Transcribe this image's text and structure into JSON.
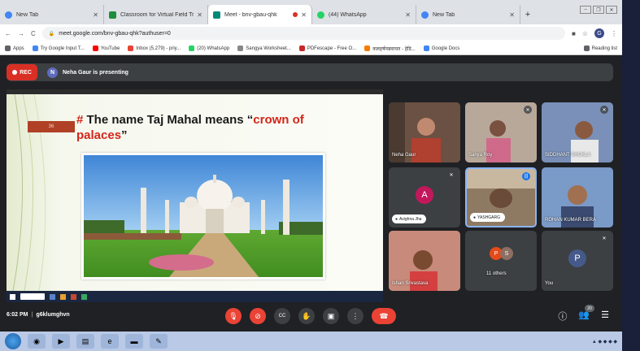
{
  "browser": {
    "tabs": [
      {
        "title": "New Tab",
        "color": "#4285f4"
      },
      {
        "title": "Classroom for Virtual Field Trip",
        "color": "#1e8e3e"
      },
      {
        "title": "Meet - bnv-gbau-qhk",
        "color": "#00897b",
        "active": true
      },
      {
        "title": "(44) WhatsApp",
        "color": "#25d366"
      },
      {
        "title": "New Tab",
        "color": "#4285f4"
      }
    ],
    "new_tab_label": "+",
    "url": "meet.google.com/bnv-gbau-qhk?authuser=0",
    "profile_initial": "G",
    "window_controls": [
      "–",
      "❐",
      "✕"
    ],
    "bookmarks": [
      {
        "label": "Apps",
        "color": "#5f6368"
      },
      {
        "label": "Try Google Input T...",
        "color": "#4285f4"
      },
      {
        "label": "YouTube",
        "color": "#ff0000"
      },
      {
        "label": "Inbox (5,279) - priy...",
        "color": "#ea4335"
      },
      {
        "label": "(20) WhatsApp",
        "color": "#25d366"
      },
      {
        "label": "Sangya Worksheet...",
        "color": "#888888"
      },
      {
        "label": "PDFescape - Free O...",
        "color": "#c62828"
      },
      {
        "label": "कलहर्षपन्नवाचन - हेडि...",
        "color": "#f57c00"
      },
      {
        "label": "Google Docs",
        "color": "#4285f4"
      }
    ],
    "reading_list": "Reading list"
  },
  "meet": {
    "rec_label": "REC",
    "presenter_initial": "N",
    "presenter_text": "Neha Gaur is presenting",
    "slide": {
      "number": "36",
      "hash": "#",
      "title_plain": " The name Taj Mahal means “",
      "title_red": "crown of palaces",
      "title_end": "”"
    },
    "participants": [
      {
        "name": "Neha Gaur",
        "type": "video",
        "color": "#7a5a48"
      },
      {
        "name": "Sanya Roy",
        "type": "video",
        "color": "#9a8078"
      },
      {
        "name": "SIDDHANT SHUKLA",
        "type": "video",
        "color": "#6a7ea0"
      },
      {
        "name": "Avighna Jha",
        "type": "avatar",
        "initial": "A",
        "color": "#c2185b"
      },
      {
        "name": "YASHGARG",
        "type": "video",
        "color": "#8a7a60"
      },
      {
        "name": "ROHAN KUMAR BERA",
        "type": "video",
        "color": "#5a7aa8"
      },
      {
        "name": "Ishan Srivastava",
        "type": "video",
        "color": "#a07070"
      },
      {
        "name": "11 others",
        "type": "others",
        "initials": [
          "P",
          "S"
        ],
        "colors": [
          "#e64a19",
          "#8d6e63"
        ]
      },
      {
        "name": "You",
        "type": "avatar",
        "initial": "P",
        "color": "#455a8a"
      }
    ],
    "time": "6:02 PM",
    "meeting_code": "g6klumghvn",
    "participants_badge": "20"
  }
}
